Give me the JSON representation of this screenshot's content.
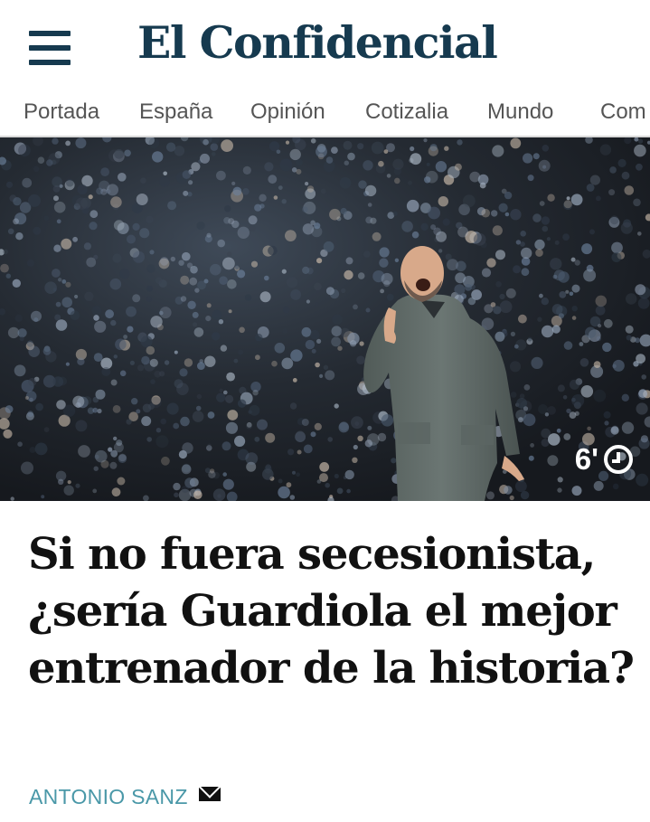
{
  "header": {
    "logo": "El Confidencial",
    "menu_icon": "hamburger-menu-icon"
  },
  "nav": {
    "items": [
      {
        "label": "Portada"
      },
      {
        "label": "España"
      },
      {
        "label": "Opinión"
      },
      {
        "label": "Cotizalia"
      },
      {
        "label": "Mundo"
      },
      {
        "label": "Com"
      }
    ]
  },
  "article": {
    "read_time": "6'",
    "read_time_icon": "clock-icon",
    "headline": "Si no fuera secesionista, ¿sería Guardiola el mejor entrenador de la historia?",
    "author": "ANTONIO SANZ",
    "author_icon": "mail-icon"
  },
  "colors": {
    "brand": "#163a4f",
    "author": "#4a98a8",
    "headline": "#111111"
  }
}
